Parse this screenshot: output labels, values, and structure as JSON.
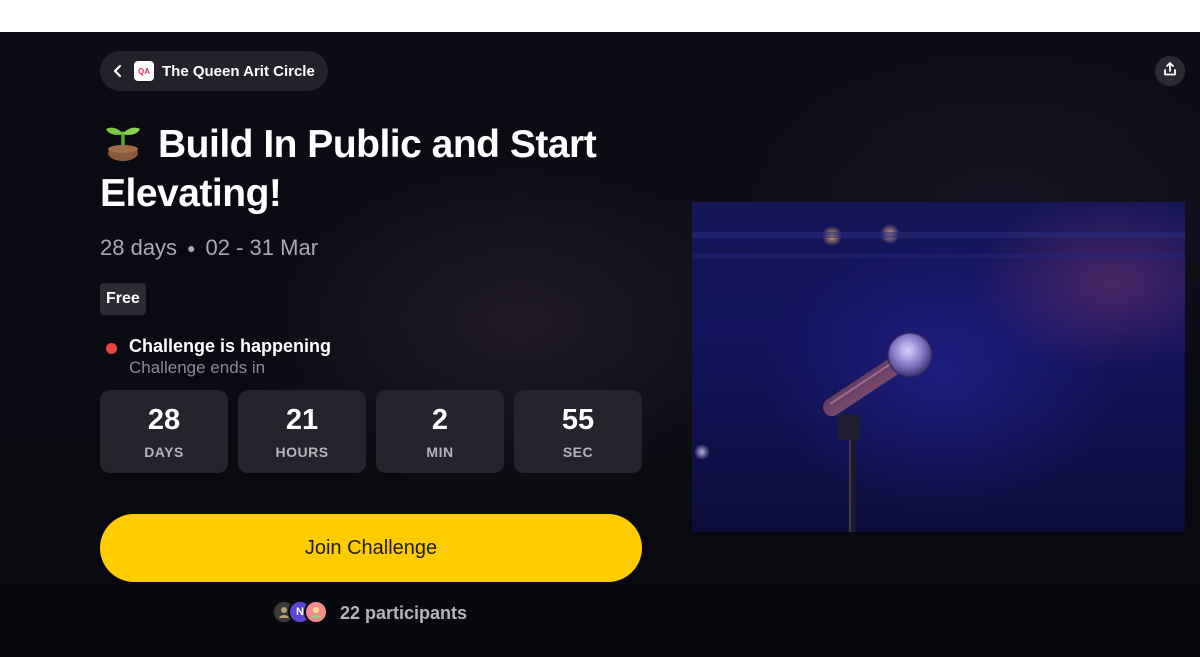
{
  "community": {
    "name": "The Queen Arit Circle",
    "logo_text": "QA"
  },
  "challenge": {
    "title": "Build In Public and Start Elevating!",
    "duration": "28 days",
    "date_range": "02 - 31 Mar",
    "price": "Free",
    "status": "Challenge is happening",
    "status_sub": "Challenge ends in",
    "countdown": [
      {
        "value": "28",
        "unit": "DAYS"
      },
      {
        "value": "21",
        "unit": "HOURS"
      },
      {
        "value": "2",
        "unit": "MIN"
      },
      {
        "value": "55",
        "unit": "SEC"
      }
    ],
    "join_label": "Join Challenge",
    "participants_label": "22 participants",
    "avatar_initial": "N"
  },
  "icons": {
    "back": "chevron-left-icon",
    "share": "share-icon",
    "title_emoji": "seedling-icon",
    "status": "red-dot"
  },
  "colors": {
    "accent": "#ffcc00",
    "status": "#ef4444",
    "background": "#0b0b14"
  }
}
